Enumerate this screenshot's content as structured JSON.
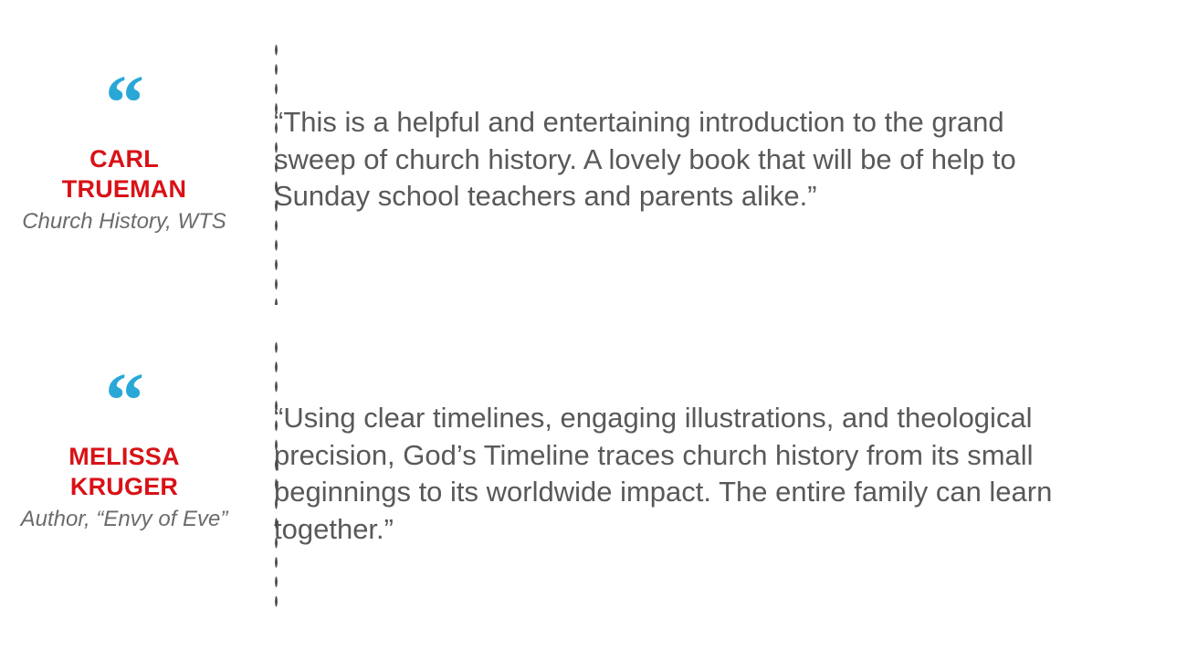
{
  "page": {
    "background_color": "#ffffff",
    "accent_blue": "#29a8d8",
    "accent_red": "#d81217",
    "body_text_color": "#58595b",
    "divider_dot_color": "#4a4a4a"
  },
  "testimonials": [
    {
      "quote_mark": "“",
      "name": "CARL TRUEMAN",
      "name_line_1": "CARL",
      "name_line_2": "TRUEMAN",
      "title": "Church History, WTS",
      "quote": "“This is a helpful and entertaining introduction to the grand sweep of church history. A lovely book that will be of help to Sunday school teachers and parents alike.”"
    },
    {
      "quote_mark": "“",
      "name": "MELISSA KRUGER",
      "name_line_1": "MELISSA",
      "name_line_2": "KRUGER",
      "title": "Author, “Envy of Eve”",
      "quote": "“Using clear timelines, engaging illustrations, and theological precision, God’s Timeline traces church history from its small beginnings to its worldwide impact. The entire family can learn together.”"
    }
  ]
}
